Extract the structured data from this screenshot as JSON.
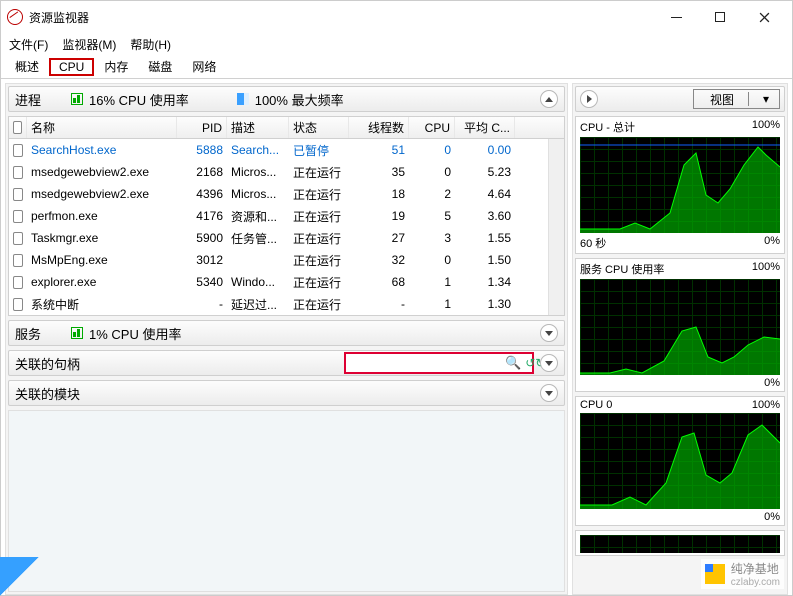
{
  "window": {
    "title": "资源监视器"
  },
  "menu": {
    "file": "文件(F)",
    "monitors": "监视器(M)",
    "help": "帮助(H)"
  },
  "tabs": {
    "overview": "概述",
    "cpu": "CPU",
    "memory": "内存",
    "disk": "磁盘",
    "network": "网络"
  },
  "processes": {
    "title": "进程",
    "cpu_usage": "16% CPU 使用率",
    "max_freq": "100% 最大频率",
    "cols": {
      "name": "名称",
      "pid": "PID",
      "desc": "描述",
      "status": "状态",
      "threads": "线程数",
      "cpu": "CPU",
      "avgc": "平均 C..."
    },
    "rows": [
      {
        "name": "SearchHost.exe",
        "pid": "5888",
        "desc": "Search...",
        "status": "已暂停",
        "threads": "51",
        "cpu": "0",
        "avgc": "0.00",
        "blue": true
      },
      {
        "name": "msedgewebview2.exe",
        "pid": "2168",
        "desc": "Micros...",
        "status": "正在运行",
        "threads": "35",
        "cpu": "0",
        "avgc": "5.23"
      },
      {
        "name": "msedgewebview2.exe",
        "pid": "4396",
        "desc": "Micros...",
        "status": "正在运行",
        "threads": "18",
        "cpu": "2",
        "avgc": "4.64"
      },
      {
        "name": "perfmon.exe",
        "pid": "4176",
        "desc": "资源和...",
        "status": "正在运行",
        "threads": "19",
        "cpu": "5",
        "avgc": "3.60"
      },
      {
        "name": "Taskmgr.exe",
        "pid": "5900",
        "desc": "任务管...",
        "status": "正在运行",
        "threads": "27",
        "cpu": "3",
        "avgc": "1.55"
      },
      {
        "name": "MsMpEng.exe",
        "pid": "3012",
        "desc": "",
        "status": "正在运行",
        "threads": "32",
        "cpu": "0",
        "avgc": "1.50"
      },
      {
        "name": "explorer.exe",
        "pid": "5340",
        "desc": "Windo...",
        "status": "正在运行",
        "threads": "68",
        "cpu": "1",
        "avgc": "1.34"
      },
      {
        "name": "系统中断",
        "pid": "-",
        "desc": "延迟过...",
        "status": "正在运行",
        "threads": "-",
        "cpu": "1",
        "avgc": "1.30"
      }
    ]
  },
  "services": {
    "title": "服务",
    "cpu_usage": "1% CPU 使用率"
  },
  "handles": {
    "title": "关联的句柄"
  },
  "modules": {
    "title": "关联的模块"
  },
  "right": {
    "view": "视图",
    "g1": {
      "label": "CPU - 总计",
      "top": "100%",
      "bl": "60 秒",
      "br": "0%"
    },
    "g2": {
      "label": "服务 CPU 使用率",
      "top": "100%",
      "br": "0%"
    },
    "g3": {
      "label": "CPU 0",
      "top": "100%",
      "br": "0%"
    }
  },
  "watermark": {
    "name": "纯净基地",
    "url": "czlaby.com"
  }
}
